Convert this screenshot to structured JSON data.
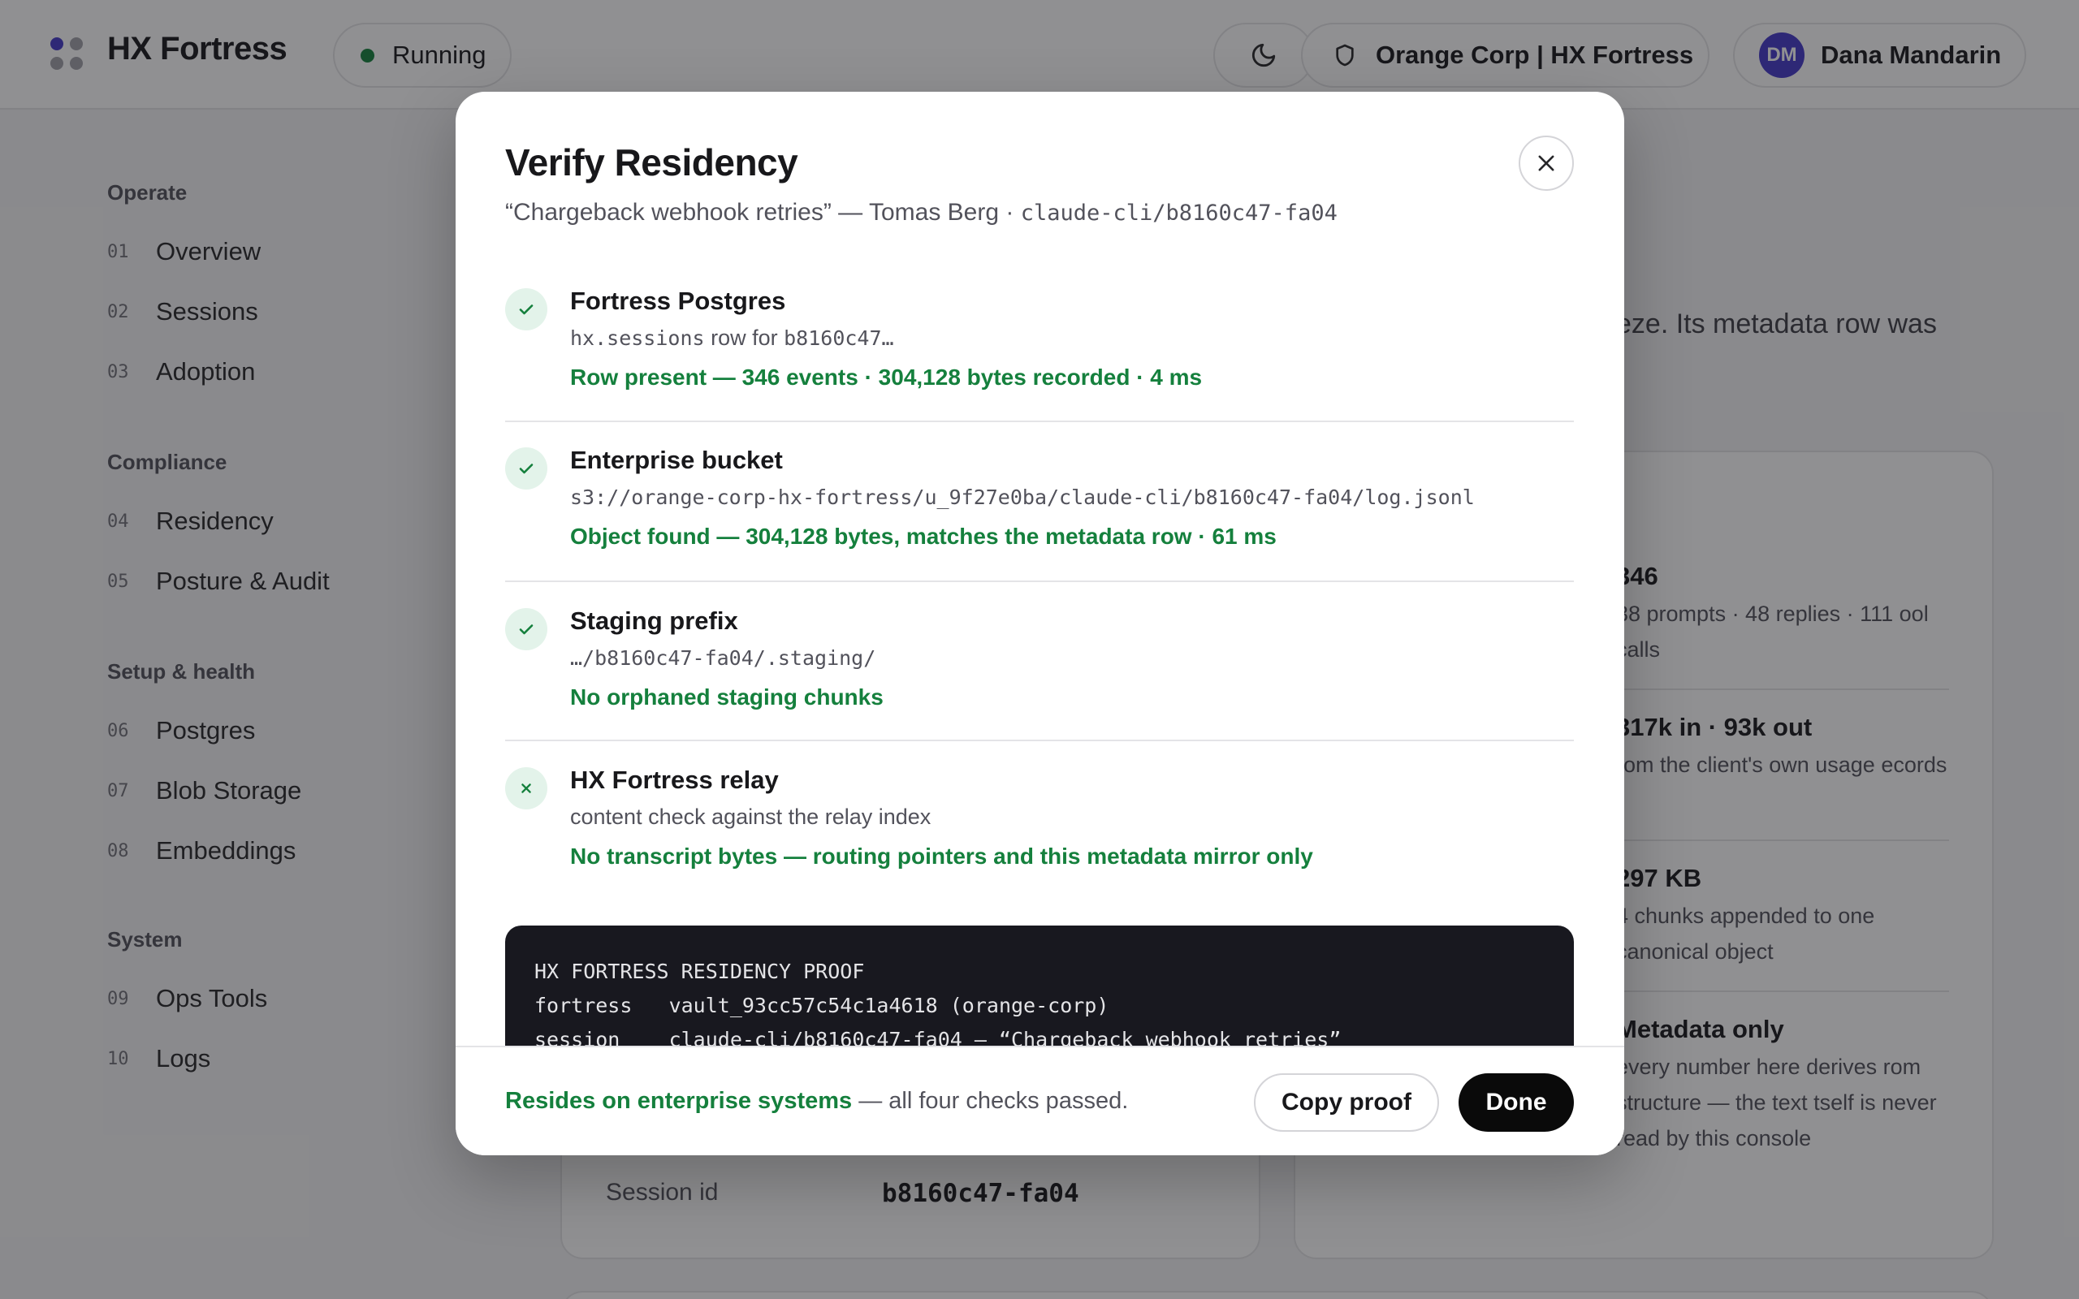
{
  "header": {
    "brand": "HX Fortress",
    "status": "Running",
    "org": "Orange Corp | HX Fortress",
    "user_initials": "DM",
    "user_name": "Dana Mandarin"
  },
  "sidebar": {
    "sections": [
      {
        "title": "Operate",
        "items": [
          {
            "num": "01",
            "label": "Overview"
          },
          {
            "num": "02",
            "label": "Sessions"
          },
          {
            "num": "03",
            "label": "Adoption"
          }
        ]
      },
      {
        "title": "Compliance",
        "items": [
          {
            "num": "04",
            "label": "Residency"
          },
          {
            "num": "05",
            "label": "Posture & Audit"
          }
        ]
      },
      {
        "title": "Setup & health",
        "items": [
          {
            "num": "06",
            "label": "Postgres"
          },
          {
            "num": "07",
            "label": "Blob Storage"
          },
          {
            "num": "08",
            "label": "Embeddings"
          }
        ]
      },
      {
        "title": "System",
        "items": [
          {
            "num": "09",
            "label": "Ops Tools"
          },
          {
            "num": "10",
            "label": "Logs"
          }
        ]
      }
    ]
  },
  "background": {
    "partial_text": "eze. Its metadata row was",
    "stats": [
      {
        "big": "346",
        "small": "38 prompts · 48 replies · 111 ool calls"
      },
      {
        "big": "317k in · 93k out",
        "small": "rom the client's own usage ecords"
      },
      {
        "big": "297 KB",
        "small": "4 chunks appended to one canonical object"
      },
      {
        "big": "Metadata only",
        "small": "every number here derives rom structure — the text tself is never read by this console"
      }
    ],
    "session_id_label": "Session id",
    "session_id_value": "b8160c47-fa04"
  },
  "modal": {
    "title": "Verify Residency",
    "subtitle_text": "“Chargeback webhook retries” — Tomas Berg · ",
    "subtitle_code": "claude-cli/b8160c47-fa04",
    "checks": [
      {
        "name": "Fortress Postgres",
        "detail_code": "hx.sessions",
        "detail_text": " row for ",
        "detail_code2": "b8160c47…",
        "result": "Row present — 346 events · 304,128 bytes recorded · 4 ms",
        "icon": "check-icon"
      },
      {
        "name": "Enterprise bucket",
        "detail_code": "s3://orange-corp-hx-fortress/u_9f27e0ba/claude-cli/b8160c47-fa04/log.jsonl",
        "result": "Object found — 304,128 bytes, matches the metadata row · 61 ms",
        "icon": "check-icon"
      },
      {
        "name": "Staging prefix",
        "detail_code": "…/b8160c47-fa04/.staging/",
        "result": "No orphaned staging chunks",
        "icon": "check-icon"
      },
      {
        "name": "HX Fortress relay",
        "detail_text": "content check against the relay index",
        "result": "No transcript bytes — routing pointers and this metadata mirror only",
        "icon": "x-icon"
      }
    ],
    "proof_lines": [
      "HX FORTRESS RESIDENCY PROOF",
      "fortress   vault_93cc57c54c1a4618 (orange-corp)",
      "session    claude-cli/b8160c47-fa04 — “Chargeback webhook retries”"
    ],
    "footer_ok": "Resides on enterprise systems",
    "footer_rest": " — all four checks passed.",
    "copy_label": "Copy proof",
    "done_label": "Done"
  },
  "colors": {
    "accent_green": "#15803d",
    "avatar": "#4338ca",
    "proof_bg": "#18181f"
  }
}
